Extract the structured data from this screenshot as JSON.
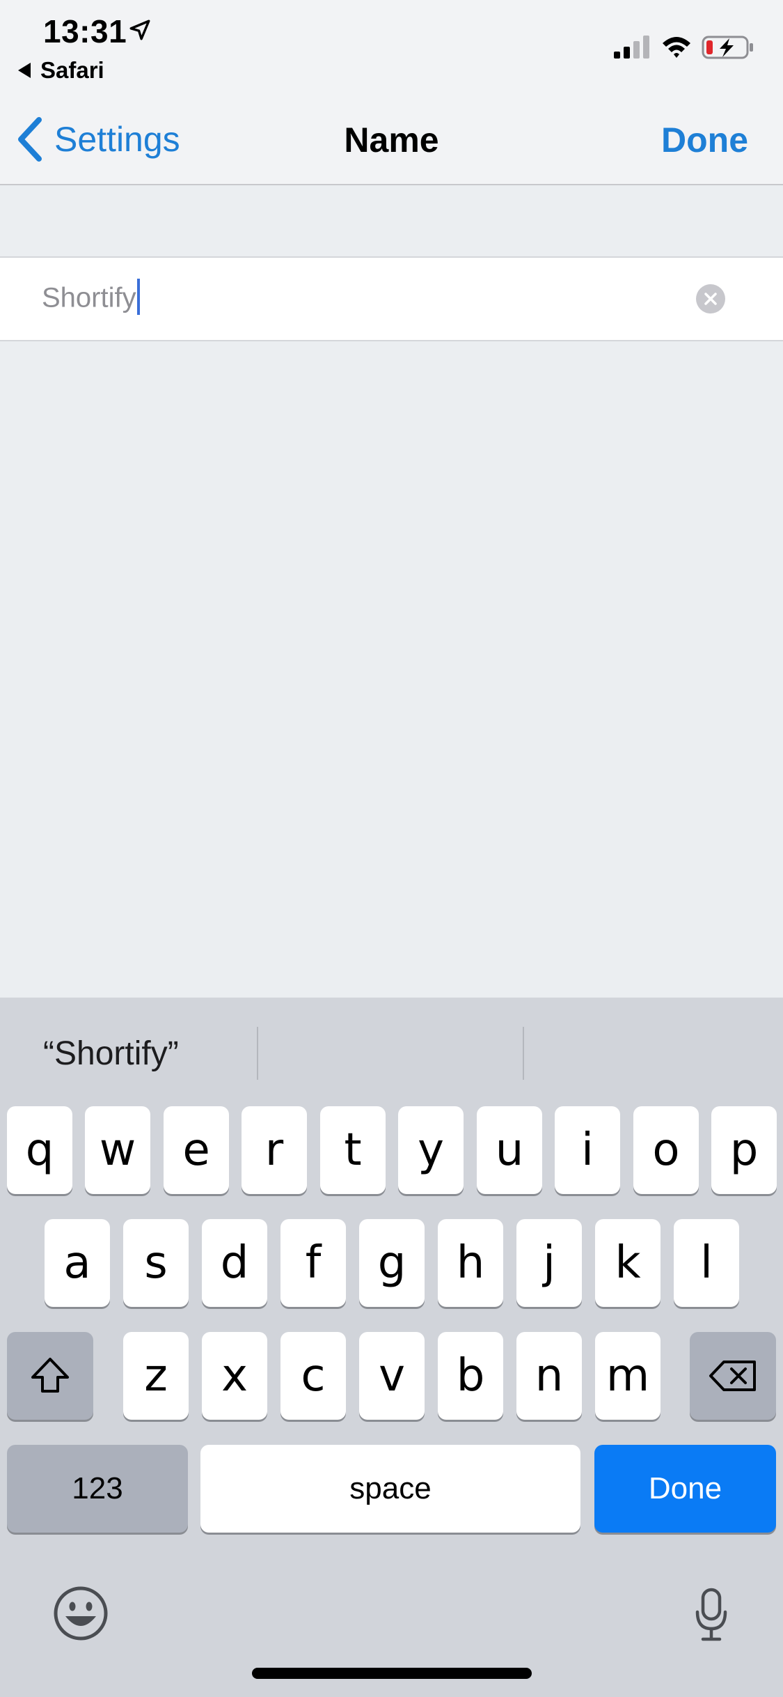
{
  "status": {
    "time": "13:31",
    "back_app": "Safari"
  },
  "nav": {
    "back_label": "Settings",
    "title": "Name",
    "done_label": "Done"
  },
  "field": {
    "value": "Shortify"
  },
  "keyboard": {
    "suggestions": [
      "“Shortify”",
      "",
      ""
    ],
    "row1": [
      "q",
      "w",
      "e",
      "r",
      "t",
      "y",
      "u",
      "i",
      "o",
      "p"
    ],
    "row2": [
      "a",
      "s",
      "d",
      "f",
      "g",
      "h",
      "j",
      "k",
      "l"
    ],
    "row3": [
      "z",
      "x",
      "c",
      "v",
      "b",
      "n",
      "m"
    ],
    "numbers_label": "123",
    "space_label": "space",
    "return_label": "Done"
  },
  "colors": {
    "accent": "#1e7fd6",
    "keyboard_done": "#0a7bf5",
    "caret": "#3a6fd8"
  }
}
